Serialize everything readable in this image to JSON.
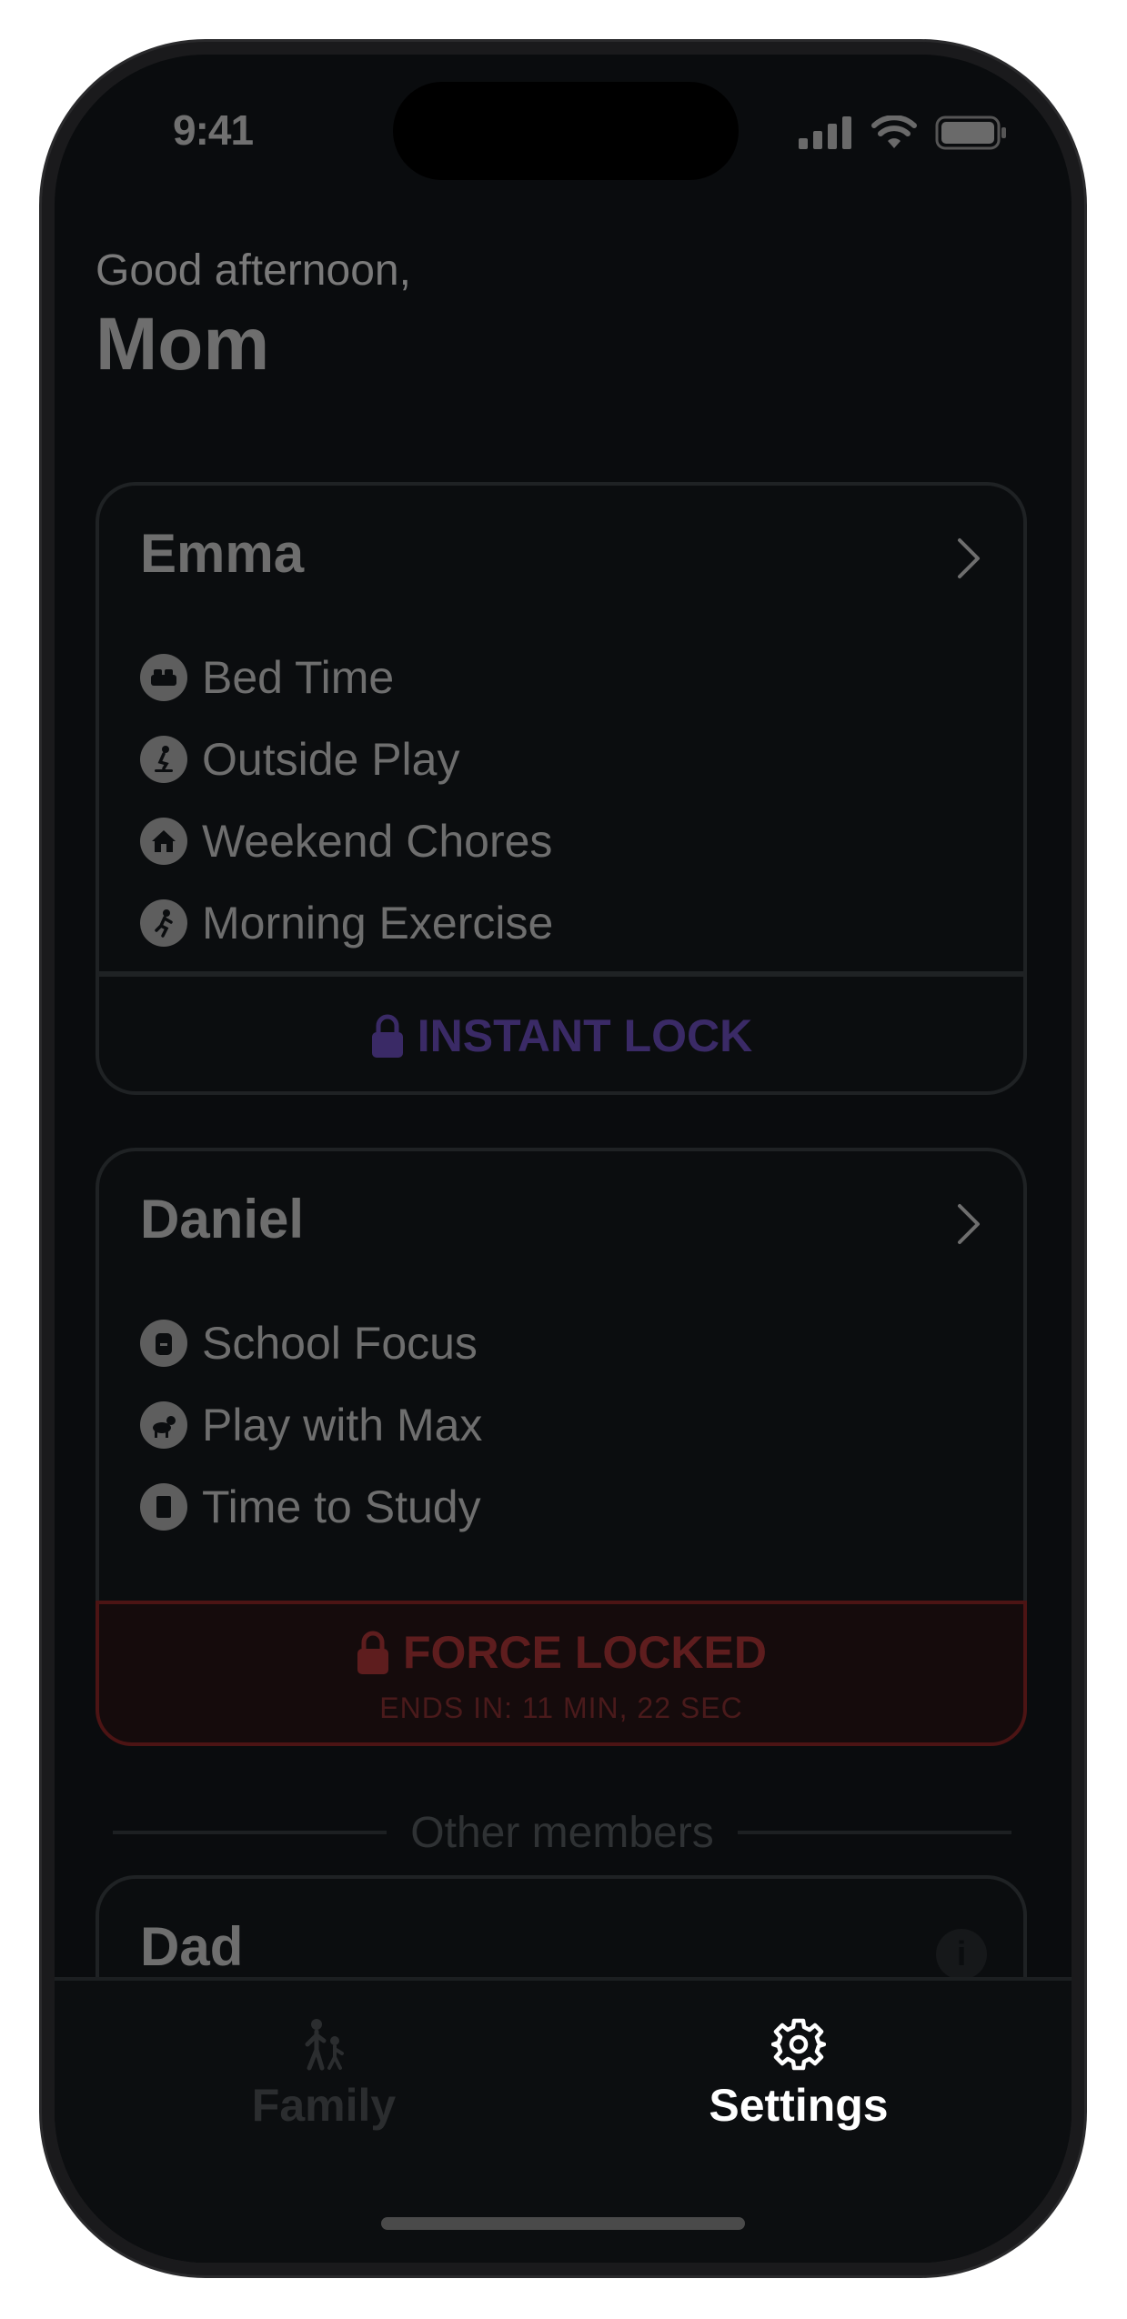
{
  "status_bar": {
    "time": "9:41"
  },
  "greeting": {
    "line1": "Good afternoon,",
    "name": "Mom"
  },
  "cards": [
    {
      "title": "Emma",
      "items": [
        {
          "icon": "bed-icon",
          "label": "Bed Time"
        },
        {
          "icon": "skateboard-icon",
          "label": "Outside Play"
        },
        {
          "icon": "house-icon",
          "label": "Weekend Chores"
        },
        {
          "icon": "running-icon",
          "label": "Morning Exercise"
        }
      ],
      "action_label": "INSTANT LOCK"
    },
    {
      "title": "Daniel",
      "items": [
        {
          "icon": "backpack-icon",
          "label": "School Focus"
        },
        {
          "icon": "dog-icon",
          "label": "Play with Max"
        },
        {
          "icon": "book-icon",
          "label": "Time to Study"
        }
      ],
      "lock_status": "FORCE LOCKED",
      "lock_timer": "ENDS IN: 11 MIN, 22 SEC"
    }
  ],
  "section_label": "Other members",
  "other_member": {
    "title": "Dad",
    "info_icon_glyph": "i"
  },
  "tabs": [
    {
      "label": "Family",
      "icon": "family-icon",
      "active": false
    },
    {
      "label": "Settings",
      "icon": "gear-icon",
      "active": true
    }
  ],
  "colors": {
    "accent_lock": "#3a2a66",
    "force_locked": "#5e1d1e",
    "active_tab": "#ffffff",
    "inactive_tab": "#2b2d2f"
  }
}
